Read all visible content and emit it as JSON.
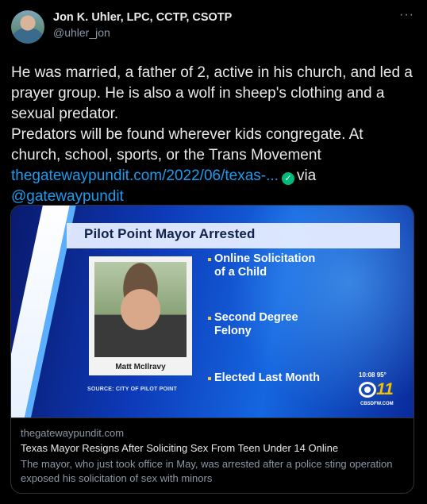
{
  "author": {
    "display_name": "Jon K. Uhler, LPC, CCTP, CSOTP",
    "handle": "@uhler_jon"
  },
  "more_label": "···",
  "tweet": {
    "lines": [
      "He was married, a father of 2, active in his church, and led a prayer group. He is also a wolf in sheep's clothing and a sexual predator.",
      "Predators will be found wherever kids congregate. At church, school, sports, or the Trans Movement"
    ],
    "link_text": "thegatewaypundit.com/2022/06/texas-...",
    "verified_icon": "✓",
    "via_text": "via",
    "mention": "@gatewaypundit"
  },
  "card": {
    "media": {
      "banner_title": "Pilot Point Mayor Arrested",
      "caption_name": "Matt McIlravy",
      "source": "SOURCE: CITY OF PILOT POINT",
      "points": [
        "Online Solicitation",
        "of a Child",
        "Second Degree",
        "Felony",
        "Elected Last Month"
      ],
      "time": "10:08",
      "temp": "95°",
      "station_number": "11",
      "station_url": "CBSDFW.COM"
    },
    "domain": "thegatewaypundit.com",
    "title": "Texas Mayor Resigns After Soliciting Sex From Teen Under 14 Online",
    "description": "The mayor, who just took office in May, was arrested after a police sting operation exposed his solicitation of sex with minors"
  },
  "colors": {
    "background": "#000000",
    "text": "#e7e9ea",
    "muted": "#8b98a5",
    "link": "#1d9bf0",
    "verified": "#00ba7c"
  }
}
